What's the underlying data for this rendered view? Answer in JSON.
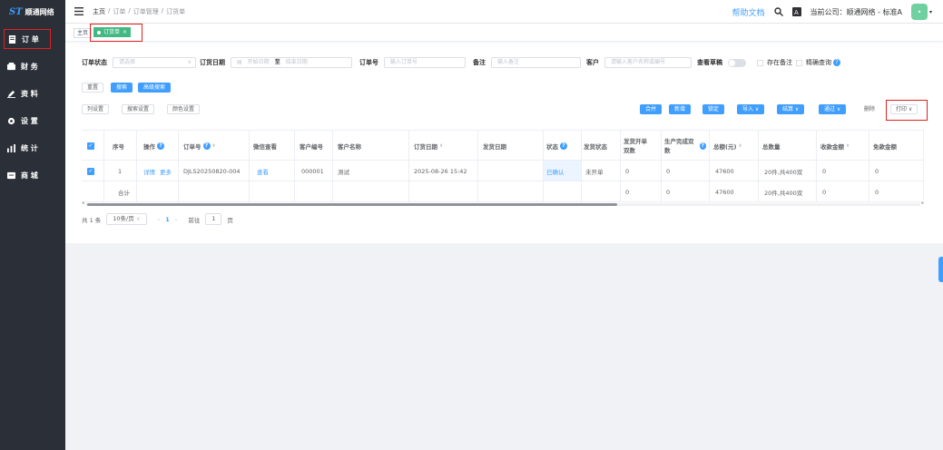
{
  "sidebar": {
    "logo": "顺通网络",
    "items": [
      {
        "label": "订 单",
        "icon": "order-icon"
      },
      {
        "label": "财 务",
        "icon": "wallet-icon"
      },
      {
        "label": "资 料",
        "icon": "edit-icon"
      },
      {
        "label": "设 置",
        "icon": "gear-icon"
      },
      {
        "label": "统 计",
        "icon": "chart-icon"
      },
      {
        "label": "商 城",
        "icon": "store-icon"
      }
    ]
  },
  "header": {
    "breadcrumb": [
      "主页",
      "订单",
      "订单管理",
      "订货单"
    ],
    "help": "帮助文档",
    "company": "当前公司：顺通网络 - 标准A"
  },
  "tags": {
    "home": "主页",
    "active": "订货单"
  },
  "filters": {
    "status_label": "订单状态",
    "status_placeholder": "请选择",
    "date_label": "订货日期",
    "date_start": "开始日期",
    "date_sep": "至",
    "date_end": "结束日期",
    "orderno_label": "订单号",
    "orderno_placeholder": "输入订单号",
    "remark_label": "备注",
    "remark_placeholder": "输入备注",
    "customer_label": "客户",
    "customer_placeholder": "请输入客户名称或编号",
    "draft_label": "查看草稿",
    "has_remark_label": "存在备注",
    "precise_label": "精确查询"
  },
  "buttons": {
    "reset": "重置",
    "search": "搜索",
    "advanced": "高级搜索",
    "columns": "列设置",
    "search_settings": "搜索设置",
    "color_settings": "颜色设置",
    "merge": "合并",
    "add": "新增",
    "lock": "锁定",
    "import": "导入 ∨",
    "settle": "结算 ∨",
    "approve": "通过 ∨",
    "delete": "删除",
    "print": "打印 ∨"
  },
  "table": {
    "headers": {
      "index": "序号",
      "action": "操作",
      "orderno": "订单号",
      "wechat": "微信查看",
      "custno": "客户编号",
      "custname": "客户名称",
      "orderdate": "订货日期",
      "shipdate": "发货日期",
      "status": "状态",
      "shipstatus": "发货状态",
      "shipopen": "发货开单双数",
      "prodfinish": "生产完成双数",
      "total": "总额(元)",
      "qty": "总数量",
      "received": "收款金额",
      "waived": "免款金额"
    },
    "rows": [
      {
        "index": "1",
        "detail": "详情",
        "more": "更多",
        "orderno": "DJLS20250820-004",
        "wechat": "查看",
        "custno": "000001",
        "custname": "测试",
        "orderdate": "2025-08-26 15:42",
        "shipdate": "",
        "status": "已确认",
        "shipstatus": "未开单",
        "shipopen": "0",
        "prodfinish": "0",
        "total": "47600",
        "qty": "20件,共400双",
        "received": "0",
        "waived": "0"
      }
    ],
    "sum": {
      "label": "合计",
      "shipopen": "0",
      "prodfinish": "0",
      "total": "47600",
      "qty": "20件,共400双",
      "received": "0",
      "waived": "0"
    }
  },
  "pagination": {
    "total": "共 1 条",
    "size": "10条/页",
    "current": "1",
    "goto_label": "前往",
    "goto_value": "1",
    "page_suffix": "页"
  }
}
